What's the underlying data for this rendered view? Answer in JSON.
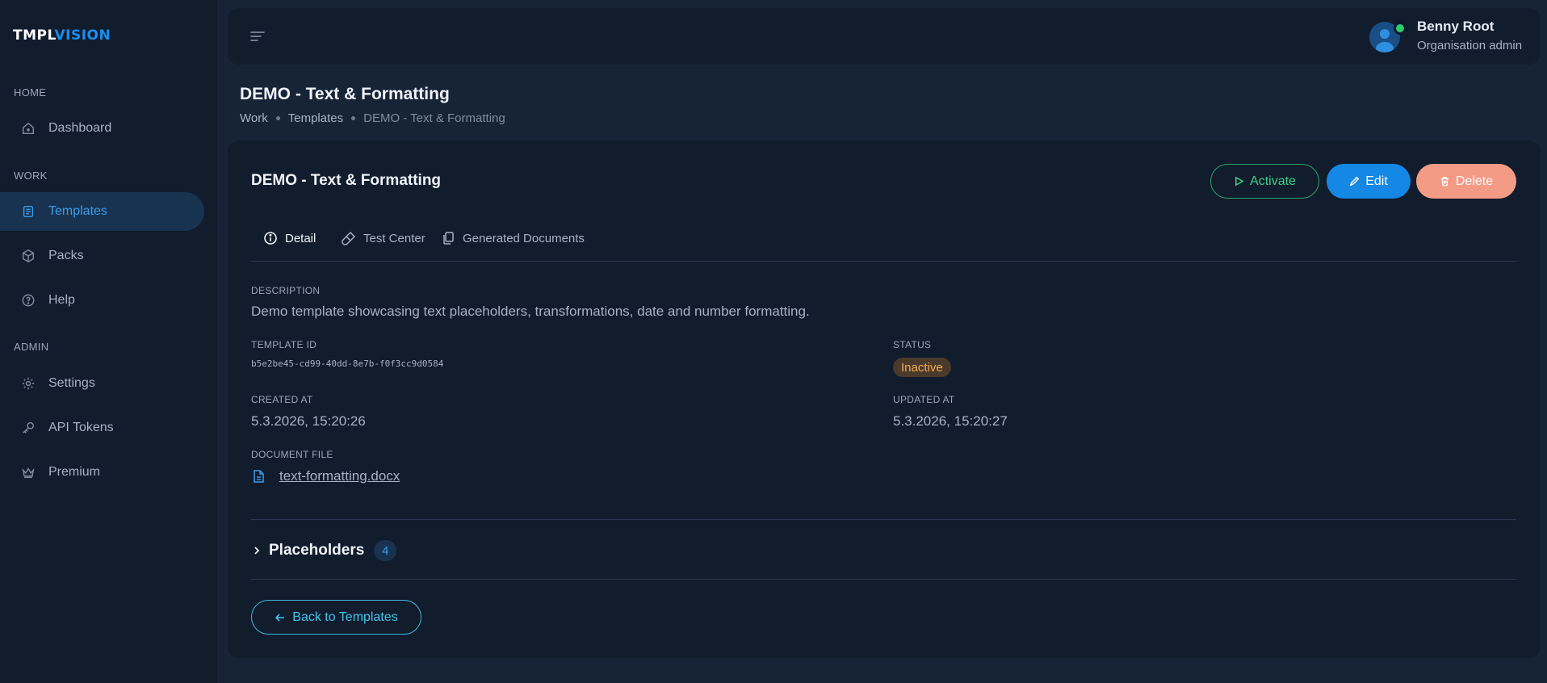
{
  "brand": {
    "part1": "TMPL",
    "part2": "VISION"
  },
  "sidebar": {
    "sections": [
      "HOME",
      "WORK",
      "ADMIN"
    ],
    "items": [
      {
        "label": "Dashboard",
        "icon": "home-icon"
      },
      {
        "label": "Templates",
        "icon": "document-icon"
      },
      {
        "label": "Packs",
        "icon": "box-icon"
      },
      {
        "label": "Help",
        "icon": "help-icon"
      },
      {
        "label": "Settings",
        "icon": "gear-icon"
      },
      {
        "label": "API Tokens",
        "icon": "key-icon"
      },
      {
        "label": "Premium",
        "icon": "crown-icon"
      }
    ]
  },
  "user": {
    "name": "Benny Root",
    "role": "Organisation admin"
  },
  "page": {
    "title": "DEMO - Text & Formatting",
    "breadcrumb": [
      "Work",
      "Templates",
      "DEMO - Text & Formatting"
    ]
  },
  "card": {
    "title": "DEMO - Text & Formatting",
    "actions": {
      "activate": "Activate",
      "edit": "Edit",
      "delete": "Delete"
    },
    "tabs": [
      "Detail",
      "Test Center",
      "Generated Documents"
    ],
    "description_label": "DESCRIPTION",
    "description": "Demo template showcasing text placeholders, transformations, date and number formatting.",
    "template_id_label": "TEMPLATE ID",
    "template_id": "b5e2be45-cd99-40dd-8e7b-f0f3cc9d0584",
    "status_label": "STATUS",
    "status": "Inactive",
    "created_label": "CREATED AT",
    "created": "5.3.2026, 15:20:26",
    "updated_label": "UPDATED AT",
    "updated": "5.3.2026, 15:20:27",
    "file_label": "DOCUMENT FILE",
    "file": "text-formatting.docx",
    "placeholders_label": "Placeholders",
    "placeholders_count": "4",
    "back_label": "Back to Templates"
  },
  "colors": {
    "accent": "#1587e5",
    "success": "#3fd08a",
    "danger": "#f49b86",
    "warning": "#f5a954"
  }
}
